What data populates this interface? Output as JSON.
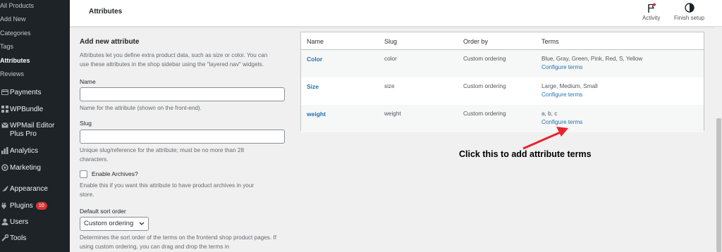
{
  "sidebar": {
    "submenu": [
      {
        "label": "All Products"
      },
      {
        "label": "Add New"
      },
      {
        "label": "Categories"
      },
      {
        "label": "Tags"
      },
      {
        "label": "Attributes",
        "current": true
      },
      {
        "label": "Reviews"
      }
    ],
    "menu": [
      {
        "icon": "payments-icon",
        "label": "Payments"
      },
      {
        "icon": "wpbundle-icon",
        "label": "WPBundle"
      },
      {
        "icon": "email-icon",
        "label": "WPMail Editor Plus Pro"
      },
      {
        "icon": "analytics-icon",
        "label": "Analytics"
      },
      {
        "icon": "marketing-icon",
        "label": "Marketing"
      },
      {
        "icon": "appearance-icon",
        "label": "Appearance"
      },
      {
        "icon": "plugins-icon",
        "label": "Plugins",
        "badge": "10"
      },
      {
        "icon": "users-icon",
        "label": "Users"
      },
      {
        "icon": "tools-icon",
        "label": "Tools"
      }
    ]
  },
  "header": {
    "title": "Attributes",
    "activity_label": "Activity",
    "finish_setup_label": "Finish setup"
  },
  "form": {
    "title": "Add new attribute",
    "intro": "Attributes let you define extra product data, such as size or color. You can use these attributes in the shop sidebar using the \"layered nav\" widgets.",
    "name_label": "Name",
    "name_value": "",
    "name_help": "Name for the attribute (shown on the front-end).",
    "slug_label": "Slug",
    "slug_value": "",
    "slug_help": "Unique slug/reference for the attribute; must be no more than 28 characters.",
    "archives_label": "Enable Archives?",
    "archives_checked": false,
    "archives_help": "Enable this if you want this attribute to have product archives in your store.",
    "sort_label": "Default sort order",
    "sort_value": "Custom ordering",
    "sort_help": "Determines the sort order of the terms on the frontend shop product pages. If using custom ordering, you can drag and drop the terms in"
  },
  "table": {
    "columns": [
      "Name",
      "Slug",
      "Order by",
      "Terms"
    ],
    "rows": [
      {
        "name": "Color",
        "slug": "color",
        "order": "Custom ordering",
        "terms": "Blue, Gray, Green, Pink, Red, S, Yellow",
        "link": "Configure terms"
      },
      {
        "name": "Size",
        "slug": "size",
        "order": "Custom ordering",
        "terms": "Large, Medium, Small",
        "link": "Configure terms"
      },
      {
        "name": "weight",
        "slug": "weight",
        "order": "Custom ordering",
        "terms": "a, b, c",
        "link": "Configure terms"
      }
    ]
  },
  "annotation": {
    "text": "Click this to add attribute terms",
    "arrow_color": "#e8222b"
  },
  "colors": {
    "sidebar_bg": "#1d2327",
    "link": "#2271b1",
    "badge": "#d63638"
  }
}
